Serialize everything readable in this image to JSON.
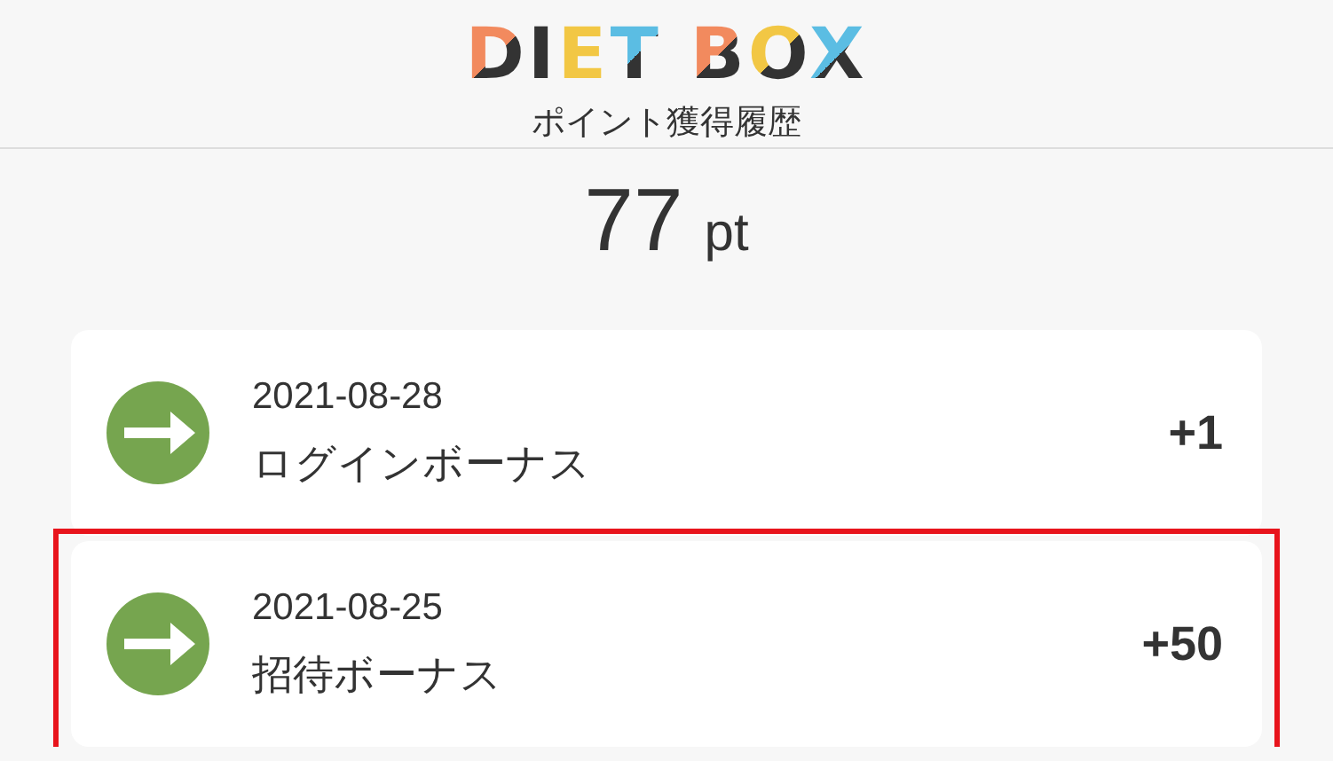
{
  "header": {
    "logo": "DIET BOX",
    "subtitle": "ポイント獲得履歴"
  },
  "total": {
    "value": "77",
    "unit": "pt"
  },
  "history": [
    {
      "date": "2021-08-28",
      "label": "ログインボーナス",
      "points": "+1",
      "highlighted": false
    },
    {
      "date": "2021-08-25",
      "label": "招待ボーナス",
      "points": "+50",
      "highlighted": true
    }
  ]
}
